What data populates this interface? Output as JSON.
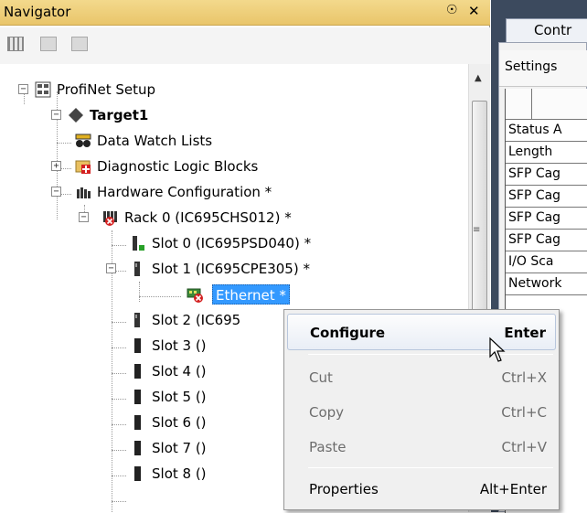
{
  "navigator": {
    "title": "Navigator",
    "pin_glyph": "p",
    "close_glyph": "x"
  },
  "toolbar": {
    "icons": [
      "grid-view-icon",
      "toolbar-icon-2",
      "toolbar-icon-3"
    ]
  },
  "tree": {
    "root": "ProfiNet Setup",
    "target": "Target1",
    "data_watch": "Data Watch Lists",
    "diag_blocks": "Diagnostic Logic Blocks",
    "hw_config": "Hardware Configuration *",
    "rack0": "Rack 0 (IC695CHS012) *",
    "slot0": "Slot 0 (IC695PSD040) *",
    "slot1": "Slot 1 (IC695CPE305) *",
    "ethernet": "Ethernet *",
    "slot2": "Slot 2 (IC695",
    "slot3": "Slot 3 ()",
    "slot4": "Slot 4 ()",
    "slot5": "Slot 5 ()",
    "slot6": "Slot 6 ()",
    "slot7": "Slot 7 ()",
    "slot8": "Slot 8 ()"
  },
  "right_panel": {
    "tab_label": "Contr",
    "subtab_label": "Settings",
    "rows": [
      "Status A",
      "Length",
      "SFP Cag",
      "SFP Cag",
      "SFP Cag",
      "SFP Cag",
      "I/O Sca",
      "Network"
    ]
  },
  "context_menu": {
    "items": [
      {
        "label": "Configure",
        "shortcut": "Enter",
        "enabled": true,
        "highlighted": true
      },
      {
        "label": "Cut",
        "shortcut": "Ctrl+X",
        "enabled": false
      },
      {
        "label": "Copy",
        "shortcut": "Ctrl+C",
        "enabled": false
      },
      {
        "label": "Paste",
        "shortcut": "Ctrl+V",
        "enabled": false
      },
      {
        "label": "Properties",
        "shortcut": "Alt+Enter",
        "enabled": true
      }
    ]
  },
  "colors": {
    "title_bar": "#f3d98c",
    "selection": "#3399ff",
    "editor_bg": "#3c4a5e"
  }
}
